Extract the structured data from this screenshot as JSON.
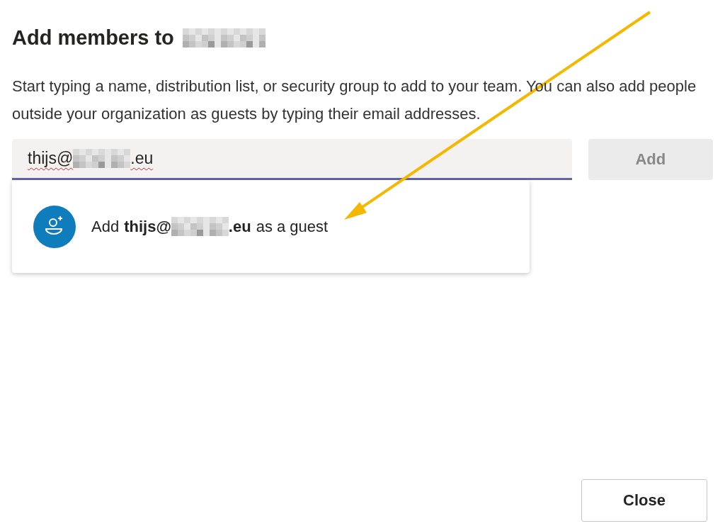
{
  "dialog": {
    "title": "Add members to",
    "title_redacted": true,
    "description": "Start typing a name, distribution list, or security group to add to your team. You can also add people outside your organization as guests by typing their email addresses.",
    "field": {
      "value_start": "thijs@",
      "value_end": ".eu",
      "redacted": true,
      "spelling_error": true,
      "focused": true
    },
    "add_button": {
      "label": "Add",
      "disabled": true
    },
    "suggestion": {
      "prefix": "Add",
      "bold_start": "thijs@",
      "bold_end": ".eu",
      "suffix": "as a guest"
    },
    "close_button": {
      "label": "Close"
    }
  },
  "annotation": {
    "kind": "arrow",
    "color": "#f5b800"
  }
}
